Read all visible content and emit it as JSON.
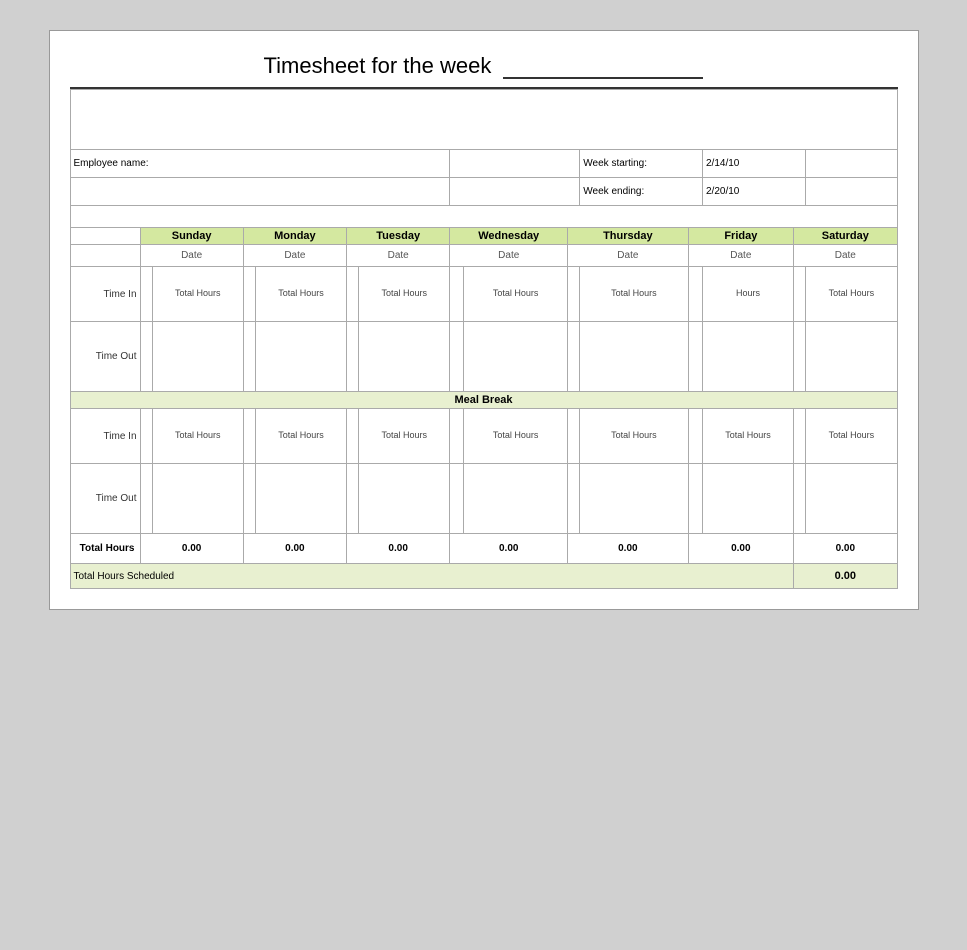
{
  "title": "Timesheet for the week",
  "employee_label": "Employee name:",
  "week_starting_label": "Week starting:",
  "week_starting_value": "2/14/10",
  "week_ending_label": "Week ending:",
  "week_ending_value": "2/20/10",
  "days": [
    "Sunday",
    "Monday",
    "Tuesday",
    "Wednesday",
    "Thursday",
    "Friday",
    "Saturday"
  ],
  "date_label": "Date",
  "time_in_label": "Time In",
  "time_out_label": "Time Out",
  "total_hours_label": "Total Hours",
  "hours_label": "Hours",
  "meal_break_label": "Meal Break",
  "total_hours_row_label": "Total Hours",
  "total_values": [
    "0.00",
    "0.00",
    "0.00",
    "0.00",
    "0.00",
    "0.00",
    "0.00"
  ],
  "scheduled_label": "Total Hours Scheduled",
  "scheduled_value": "0.00"
}
